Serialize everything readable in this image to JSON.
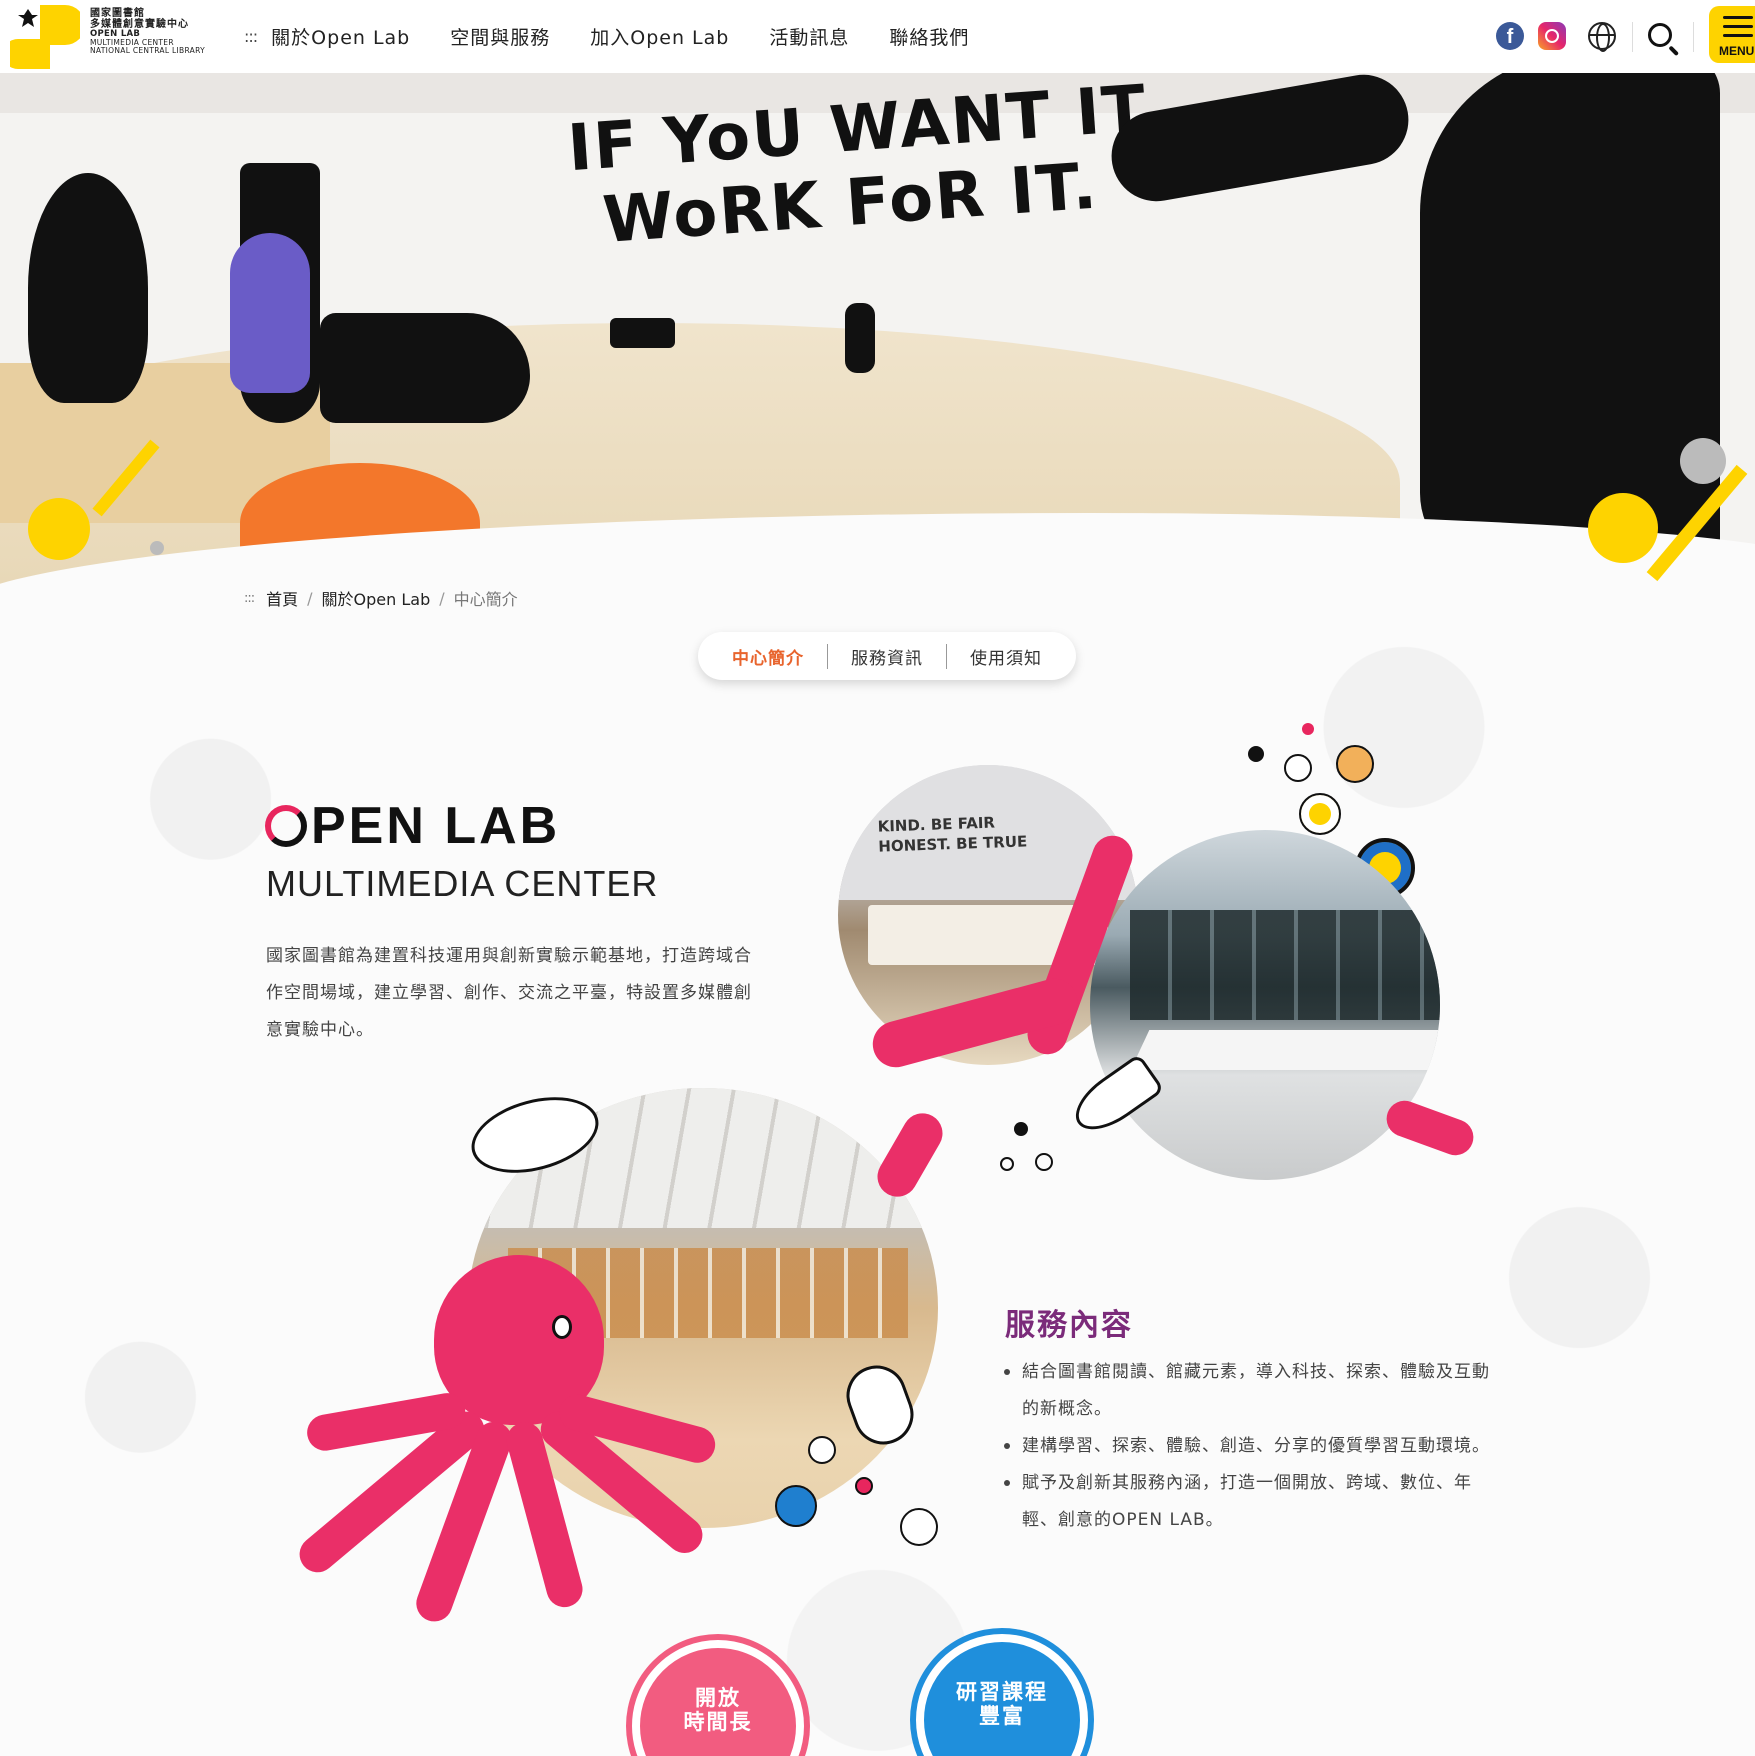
{
  "header": {
    "logo": {
      "zh_line1": "國家圖書館",
      "zh_line2": "多媒體創意實驗中心",
      "en_line1": "OPEN LAB",
      "en_line2": "MULTIMEDIA CENTER",
      "en_line3": "NATIONAL CENTRAL LIBRARY"
    },
    "nav_dots": ":::",
    "nav": [
      {
        "label": "關於Open Lab"
      },
      {
        "label": "空間與服務"
      },
      {
        "label": "加入Open Lab"
      },
      {
        "label": "活動訊息"
      },
      {
        "label": "聯絡我們"
      }
    ],
    "social": {
      "facebook_glyph": "f"
    },
    "menu_label": "MENU",
    "icons": [
      "facebook-icon",
      "instagram-icon",
      "globe-icon",
      "search-icon",
      "hamburger-icon"
    ]
  },
  "hero": {
    "wall_text_line1": "IF YoU WANT IT",
    "wall_text_line2": "WoRK FoR IT."
  },
  "breadcrumb": {
    "dots": ":::",
    "items": [
      "首頁",
      "關於Open Lab",
      "中心簡介"
    ],
    "separator": "/"
  },
  "tabs": [
    {
      "label": "中心簡介",
      "active": true
    },
    {
      "label": "服務資訊",
      "active": false
    },
    {
      "label": "使用須知",
      "active": false
    }
  ],
  "intro": {
    "title_rest": "PEN  LAB",
    "subtitle": "MULTIMEDIA CENTER",
    "text": "國家圖書館為建置科技運用與創新實驗示範基地，打造跨域合作空間場域，建立學習、創作、交流之平臺，特設置多媒體創意實驗中心。",
    "photo_wall_text": "KIND. BE FAIR\nHONEST. BE TRUE"
  },
  "services": {
    "title": "服務內容",
    "items": [
      "結合圖書館閱讀、館藏元素，導入科技、探索、體驗及互動的新概念。",
      "建構學習、探索、體驗、創造、分享的優質學習互動環境。",
      "賦予及創新其服務內涵，打造一個開放、跨域、數位、年輕、創意的OPEN LAB。"
    ]
  },
  "badges": [
    {
      "line1": "開放",
      "line2": "時間長",
      "color": "#f25c80"
    },
    {
      "line1": "研習課程",
      "line2": "豐富",
      "color": "#1f8fdc"
    }
  ],
  "colors": {
    "brand_yellow": "#fed300",
    "active_tab": "#e8642d",
    "octopus_pink": "#ea2f68",
    "service_title": "#7b2b7a"
  }
}
